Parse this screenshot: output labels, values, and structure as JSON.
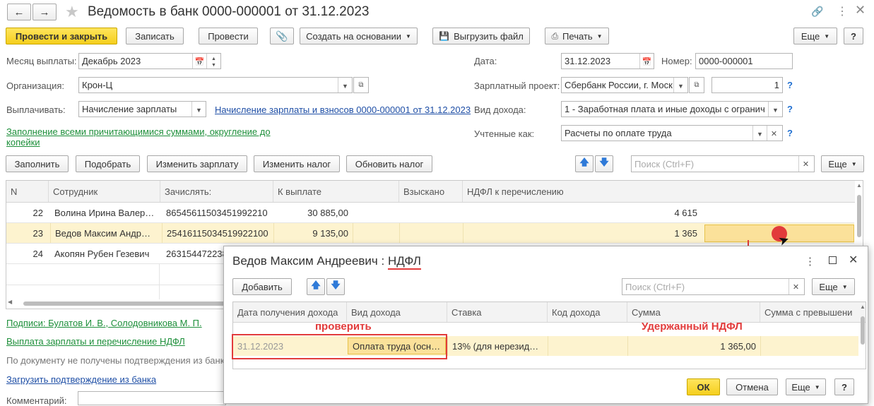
{
  "window": {
    "title": "Ведомость в банк 0000-000001 от 31.12.2023"
  },
  "toolbar": {
    "post_close": "Провести и закрыть",
    "save": "Записать",
    "post": "Провести",
    "create_based": "Создать на основании",
    "export_file": "Выгрузить файл",
    "print": "Печать",
    "more": "Еще",
    "help": "?"
  },
  "form": {
    "month_label": "Месяц выплаты:",
    "month_value": "Декабрь 2023",
    "org_label": "Организация:",
    "org_value": "Крон-Ц",
    "pay_label": "Выплачивать:",
    "pay_value": "Начисление зарплаты",
    "pay_link": "Начисление зарплаты и взносов 0000-000001 от 31.12.2023",
    "fill_link_1": "Заполнение всеми причитающимися суммами, округление до",
    "fill_link_2": "копейки",
    "date_label": "Дата:",
    "date_value": "31.12.2023",
    "number_label": "Номер:",
    "number_value": "0000-000001",
    "project_label": "Зарплатный проект:",
    "project_value": "Сбербанк России, г. Моск",
    "project_count": "1",
    "income_label": "Вид дохода:",
    "income_value": "1 - Заработная плата и иные доходы с огранич",
    "counted_label": "Учтенные как:",
    "counted_value": "Расчеты по оплате труда"
  },
  "table_toolbar": {
    "fill": "Заполнить",
    "pick": "Подобрать",
    "change_salary": "Изменить зарплату",
    "change_tax": "Изменить налог",
    "update_tax": "Обновить налог",
    "search_placeholder": "Поиск (Ctrl+F)",
    "more": "Еще"
  },
  "table": {
    "headers": [
      "N",
      "Сотрудник",
      "Зачислять:",
      "К выплате",
      "Взыскано",
      "НДФЛ к перечислению"
    ],
    "rows": [
      {
        "n": "22",
        "employee": "Волина Ирина Валер…",
        "account": "86545611503451992210",
        "pay": "30 885,00",
        "withheld": "",
        "ndfl": "4 615"
      },
      {
        "n": "23",
        "employee": "Ведов Максим Андр…",
        "account": "25416115034519922100",
        "pay": "9 135,00",
        "withheld": "",
        "ndfl": "1 365"
      },
      {
        "n": "24",
        "employee": "Акопян Рубен Гезевич",
        "account": "263154472238",
        "pay": "",
        "withheld": "",
        "ndfl": ""
      }
    ]
  },
  "footer": {
    "signatures_link": "Подписи: Булатов И. В., Солодовникова М. П.",
    "payout_link": "Выплата зарплаты и перечисление НДФЛ",
    "no_confirm": "По документу не получены подтверждения из банк",
    "load_confirm": "Загрузить подтверждение из банка",
    "comment_label": "Комментарий:"
  },
  "dialog": {
    "title_name": "Ведов Максим Андреевич",
    "title_sep": " : ",
    "title_tail": "НДФЛ",
    "add": "Добавить",
    "search_placeholder": "Поиск (Ctrl+F)",
    "more": "Еще",
    "headers": [
      "Дата получения дохода",
      "Вид дохода",
      "Ставка",
      "Код дохода",
      "Сумма",
      "Сумма с превышени"
    ],
    "row": {
      "date": "31.12.2023",
      "income_type": "Оплата труда (осн…",
      "rate": "13% (для нерезид…",
      "code": "",
      "sum": "1 365,00",
      "sum_excess": ""
    },
    "annotation_check": "проверить",
    "annotation_withheld": "Удержанный НДФЛ",
    "ok": "ОК",
    "cancel": "Отмена",
    "help": "?"
  },
  "colors": {
    "accent_yellow": "#f5cf1d",
    "selected_row": "#fdf3cf",
    "highlight_red": "#e23b3b",
    "link_green": "#1d8f3a",
    "link_blue": "#1f4fa6"
  }
}
